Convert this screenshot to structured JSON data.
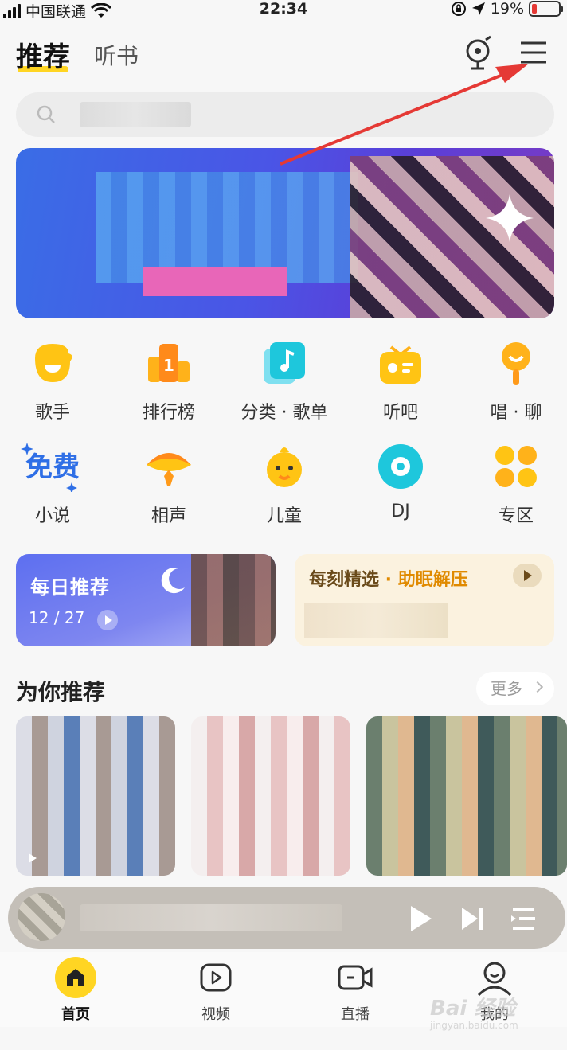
{
  "status_bar": {
    "carrier": "中国联通",
    "time": "22:34",
    "battery_pct": "19%",
    "battery_level": 0.19
  },
  "tabs": [
    {
      "label": "推荐",
      "active": true
    },
    {
      "label": "听书",
      "active": false
    }
  ],
  "shortcuts": [
    {
      "label": "歌手",
      "icon": "singer-icon"
    },
    {
      "label": "排行榜",
      "icon": "chart-icon"
    },
    {
      "label": "分类 · 歌单",
      "icon": "playlist-icon"
    },
    {
      "label": "听吧",
      "icon": "radio-icon"
    },
    {
      "label": "唱 · 聊",
      "icon": "mic-chat-icon"
    },
    {
      "label": "小说",
      "icon": "free-novel-icon",
      "badge": "免费"
    },
    {
      "label": "相声",
      "icon": "fan-icon"
    },
    {
      "label": "儿童",
      "icon": "kids-icon"
    },
    {
      "label": "DJ",
      "icon": "disc-icon"
    },
    {
      "label": "专区",
      "icon": "grid-icon"
    }
  ],
  "daily": {
    "title": "每日推荐",
    "date": "12 / 27"
  },
  "moment": {
    "title": "每刻精选",
    "separator": " · ",
    "subtitle": "助眠解压"
  },
  "recommend": {
    "title": "为你推荐",
    "more": "更多"
  },
  "nav": [
    {
      "label": "首页",
      "icon": "home-icon",
      "active": true
    },
    {
      "label": "视频",
      "icon": "video-icon",
      "active": false
    },
    {
      "label": "直播",
      "icon": "live-icon",
      "active": false
    },
    {
      "label": "我的",
      "icon": "profile-icon",
      "active": false
    }
  ],
  "watermark": {
    "text": "Bai 经验",
    "sub": "jingyan.baidu.com"
  },
  "colors": {
    "accent": "#ffd523",
    "arrow": "#e53935"
  }
}
